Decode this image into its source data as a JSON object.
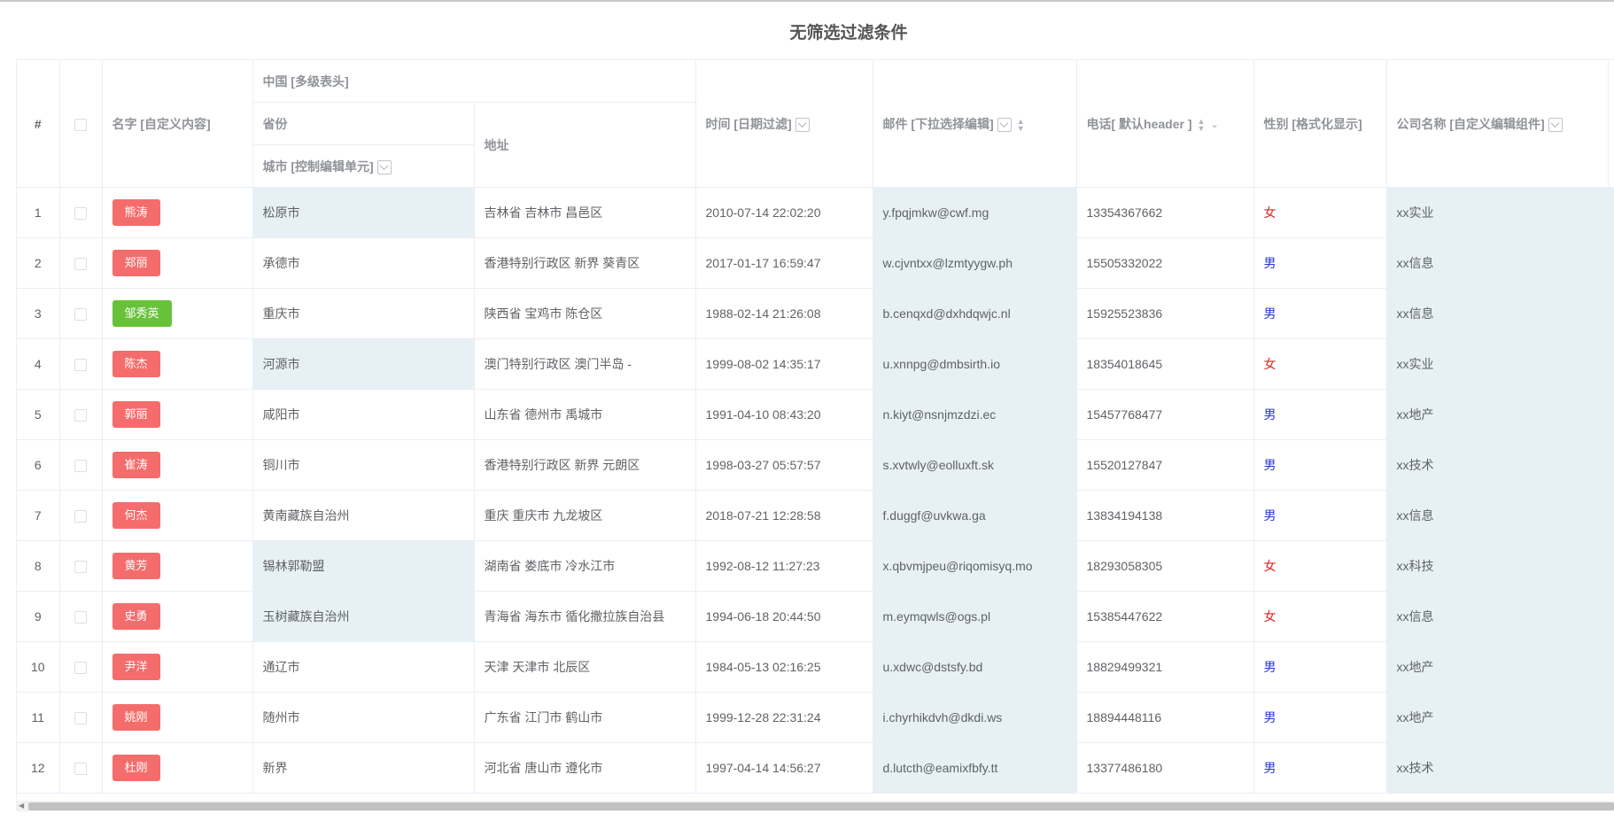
{
  "title": "无筛选过滤条件",
  "header": {
    "index": "#",
    "name": "名字 [自定义内容]",
    "group": "中国 [多级表头]",
    "province": "省份",
    "city": "城市 [控制编辑单元]",
    "address": "地址",
    "time": "时间 [日期过滤]",
    "email": "邮件 [下拉选择编辑]",
    "phone": "电话[ 默认header ]",
    "gender": "性别 [格式化显示]",
    "company": "公司名称 [自定义编辑组件]"
  },
  "rows": [
    {
      "idx": "1",
      "name": "熊涛",
      "tag": "red",
      "city": "松原市",
      "addr": "吉林省 吉林市 昌邑区",
      "time": "2010-07-14 22:02:20",
      "email": "y.fpqjmkw@cwf.mg",
      "phone": "13354367662",
      "gender": "女",
      "company": "xx实业",
      "hl": true
    },
    {
      "idx": "2",
      "name": "郑丽",
      "tag": "red",
      "city": "承德市",
      "addr": "香港特别行政区 新界 葵青区",
      "time": "2017-01-17 16:59:47",
      "email": "w.cjvntxx@lzmtyygw.ph",
      "phone": "15505332022",
      "gender": "男",
      "company": "xx信息",
      "hl": false
    },
    {
      "idx": "3",
      "name": "邹秀英",
      "tag": "green",
      "city": "重庆市",
      "addr": "陕西省 宝鸡市 陈仓区",
      "time": "1988-02-14 21:26:08",
      "email": "b.cenqxd@dxhdqwjc.nl",
      "phone": "15925523836",
      "gender": "男",
      "company": "xx信息",
      "hl": false
    },
    {
      "idx": "4",
      "name": "陈杰",
      "tag": "red",
      "city": "河源市",
      "addr": "澳门特别行政区 澳门半岛 -",
      "time": "1999-08-02 14:35:17",
      "email": "u.xnnpg@dmbsirth.io",
      "phone": "18354018645",
      "gender": "女",
      "company": "xx实业",
      "hl": true
    },
    {
      "idx": "5",
      "name": "郭丽",
      "tag": "red",
      "city": "咸阳市",
      "addr": "山东省 德州市 禹城市",
      "time": "1991-04-10 08:43:20",
      "email": "n.kiyt@nsnjmzdzi.ec",
      "phone": "15457768477",
      "gender": "男",
      "company": "xx地产",
      "hl": false
    },
    {
      "idx": "6",
      "name": "崔涛",
      "tag": "red",
      "city": "铜川市",
      "addr": "香港特别行政区 新界 元朗区",
      "time": "1998-03-27 05:57:57",
      "email": "s.xvtwly@eolluxft.sk",
      "phone": "15520127847",
      "gender": "男",
      "company": "xx技术",
      "hl": false
    },
    {
      "idx": "7",
      "name": "何杰",
      "tag": "red",
      "city": "黄南藏族自治州",
      "addr": "重庆 重庆市 九龙坡区",
      "time": "2018-07-21 12:28:58",
      "email": "f.duggf@uvkwa.ga",
      "phone": "13834194138",
      "gender": "男",
      "company": "xx信息",
      "hl": false
    },
    {
      "idx": "8",
      "name": "黄芳",
      "tag": "red",
      "city": "锡林郭勒盟",
      "addr": "湖南省 娄底市 冷水江市",
      "time": "1992-08-12 11:27:23",
      "email": "x.qbvmjpeu@riqomisyq.mo",
      "phone": "18293058305",
      "gender": "女",
      "company": "xx科技",
      "hl": true
    },
    {
      "idx": "9",
      "name": "史勇",
      "tag": "red",
      "city": "玉树藏族自治州",
      "addr": "青海省 海东市 循化撒拉族自治县",
      "time": "1994-06-18 20:44:50",
      "email": "m.eymqwls@ogs.pl",
      "phone": "15385447622",
      "gender": "女",
      "company": "xx信息",
      "hl": true
    },
    {
      "idx": "10",
      "name": "尹洋",
      "tag": "red",
      "city": "通辽市",
      "addr": "天津 天津市 北辰区",
      "time": "1984-05-13 02:16:25",
      "email": "u.xdwc@dstsfy.bd",
      "phone": "18829499321",
      "gender": "男",
      "company": "xx地产",
      "hl": false
    },
    {
      "idx": "11",
      "name": "姚刚",
      "tag": "red",
      "city": "随州市",
      "addr": "广东省 江门市 鹤山市",
      "time": "1999-12-28 22:31:24",
      "email": "i.chyrhikdvh@dkdi.ws",
      "phone": "18894448116",
      "gender": "男",
      "company": "xx地产",
      "hl": false
    },
    {
      "idx": "12",
      "name": "杜刚",
      "tag": "red",
      "city": "新界",
      "addr": "河北省 唐山市 遵化市",
      "time": "1997-04-14 14:56:27",
      "email": "d.lutcth@eamixfbfy.tt",
      "phone": "13377486180",
      "gender": "男",
      "company": "xx技术",
      "hl": false
    }
  ]
}
